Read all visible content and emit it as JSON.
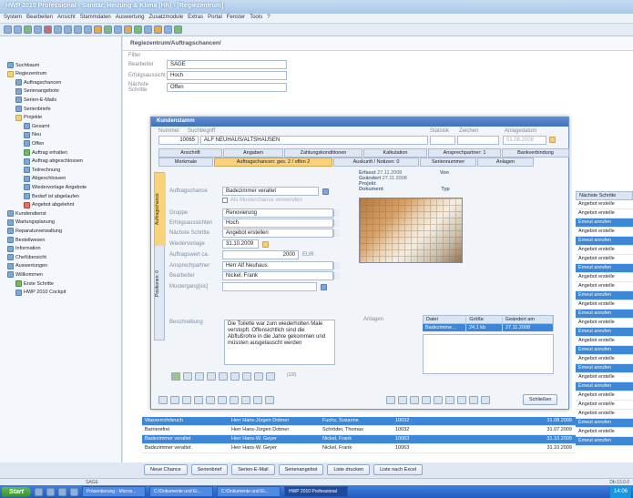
{
  "app": {
    "title": "HWP 2010 Professional - Sanitär, Heizung & Klima (Hh) - [Regiezentrum]"
  },
  "menu": [
    "System",
    "Bearbeiten",
    "Ansicht",
    "Stammdaten",
    "Auswertung",
    "Zusatzmodule",
    "Extras",
    "Portal",
    "Fenster",
    "Tools",
    "?"
  ],
  "sidebar": {
    "items": [
      {
        "label": "Suchbaum",
        "indent": 0,
        "icon": "search-icon"
      },
      {
        "label": "Regiezentrum",
        "indent": 0,
        "icon": "folder-icon"
      },
      {
        "label": "Auftragschancen",
        "indent": 1,
        "icon": "star-icon"
      },
      {
        "label": "Serienangebote",
        "indent": 1,
        "icon": "document-icon"
      },
      {
        "label": "Serien-E-Mails",
        "indent": 1,
        "icon": "mail-icon"
      },
      {
        "label": "Serienbriefe",
        "indent": 1,
        "icon": "letter-icon"
      },
      {
        "label": "Projekte",
        "indent": 1,
        "icon": "folder-icon"
      },
      {
        "label": "Gesamt",
        "indent": 2,
        "icon": "list-icon"
      },
      {
        "label": "Neu",
        "indent": 2,
        "icon": "document-icon"
      },
      {
        "label": "Offen",
        "indent": 2,
        "icon": "document-icon"
      },
      {
        "label": "Auftrag erhalten",
        "indent": 2,
        "icon": "check-icon"
      },
      {
        "label": "Auftrag abgeschlossen",
        "indent": 2,
        "icon": "document-icon"
      },
      {
        "label": "Teilrechnung",
        "indent": 2,
        "icon": "document-icon"
      },
      {
        "label": "Abgeschlossen",
        "indent": 2,
        "icon": "document-icon"
      },
      {
        "label": "Wiedervorlage Angebote",
        "indent": 2,
        "icon": "document-icon"
      },
      {
        "label": "Bedarf ist abgelaufen",
        "indent": 2,
        "icon": "document-icon"
      },
      {
        "label": "Angebot abgelehnt",
        "indent": 2,
        "icon": "stop-icon"
      },
      {
        "label": "Kundendienst",
        "indent": 0,
        "icon": "tools-icon"
      },
      {
        "label": "Wartungsplanung",
        "indent": 0,
        "icon": "calendar-icon"
      },
      {
        "label": "Reparaturverwaltung",
        "indent": 0,
        "icon": "wrench-icon"
      },
      {
        "label": "Bestellwesen",
        "indent": 0,
        "icon": "cart-icon"
      },
      {
        "label": "Information",
        "indent": 0,
        "icon": "info-icon"
      },
      {
        "label": "Chefübersicht",
        "indent": 0,
        "icon": "info-icon"
      },
      {
        "label": "Auswertungen",
        "indent": 0,
        "icon": "chart-icon"
      },
      {
        "label": "Willkommen",
        "indent": 0,
        "icon": "info-icon"
      },
      {
        "label": "Erste Schritte",
        "indent": 1,
        "icon": "help-icon"
      },
      {
        "label": "HWP 2010 Cockpit",
        "indent": 1,
        "icon": "cockpit-icon"
      }
    ]
  },
  "main": {
    "header": "Regiezentrum/Auftragschancen/",
    "filter": {
      "title": "Filter",
      "fields": [
        {
          "label": "Bearbeiter",
          "value": "SAGE"
        },
        {
          "label": "Erfolgsaussicht",
          "value": "Hoch"
        },
        {
          "label": "Nächste Schritte",
          "value": "Offen"
        }
      ]
    }
  },
  "dialog": {
    "title": "Kundenstamm",
    "nummer_label": "Nummer",
    "suchbegriff_label": "Suchbegriff",
    "nummer": "10065",
    "suchbegriff": "ALF NEUHAUS/ALTSHAUSEN",
    "statistik_label": "Statistik",
    "zeichen_label": "Zeichen",
    "anlagedatum_label": "Anlagedatum",
    "anlagedatum": "01.08.2008",
    "tabs_top": [
      "Anschrift",
      "Angaben",
      "Zahlungskonditionen",
      "Kalkulation",
      "Ansprechpartner: 1",
      "Bankverbindung"
    ],
    "tabs_second": [
      "Merkmale",
      "Auftragschancen: ges. 2 / offen 2",
      "Auskunft / Notizen: 0",
      "Seriennummer",
      "Anlagen"
    ],
    "vtabs": [
      "Auftragschance",
      "Positionen: 0"
    ],
    "fields": [
      {
        "label": "Auftragschance",
        "value": "Badezimmer veraltet"
      },
      {
        "label": "",
        "value": "Als Musterchance verwenden"
      },
      {
        "label": "Gruppe",
        "value": "Renovierung"
      },
      {
        "label": "Erfolgsaussichten",
        "value": "Hoch"
      },
      {
        "label": "Nächste Schritte",
        "value": "Angebot erstellen"
      },
      {
        "label": "Wiedervorlage",
        "value": "31.10.2009"
      },
      {
        "label": "Auftragswert ca.",
        "value": "2000"
      },
      {
        "label": "Ansprechpartner",
        "value": "Herr Alf Neuhaus"
      },
      {
        "label": "Bearbeiter",
        "value": "Nickel, Frank"
      },
      {
        "label": "Mustergang[sic]",
        "value": ""
      },
      {
        "label": "Beschreibung",
        "value": "Die Toilette war zum wiederholten Male verstopft. Offensichtlich sind die Abflußrohre in die Jahre gekommen und müssten ausgetauscht werden"
      }
    ],
    "currency": "EUR",
    "info": {
      "erfasst_label": "Erfasst",
      "erfasst": "27.11.2008",
      "geaendert_label": "Geändert",
      "geaendert": "27.11.2008",
      "von_label": "Von",
      "projekt_label": "Projekt",
      "dokument_label": "Dokument",
      "typ_label": "Typ"
    },
    "anlagen": {
      "label": "Anlagen",
      "headers": [
        "Datei",
        "Größe",
        "Geändert am"
      ],
      "row": [
        "Badezimme...",
        "24,1 kb",
        "27.11.2008"
      ]
    },
    "record_counter": "(1/2)",
    "schliessen": "Schließen"
  },
  "right_column": {
    "header": "Nächste Schritte",
    "rows": [
      "Angebot erstelle",
      "Angebot erstelle",
      "Emeut anrufen",
      "Angebot erstelle",
      "Emeut anrufen",
      "Angebot erstelle",
      "Angebot erstelle",
      "Emeut anrufen",
      "Angebot erstelle",
      "Angebot erstelle",
      "Emeut anrufen",
      "Angebot erstelle",
      "Emeut anrufen",
      "Angebot erstelle",
      "Emeut anrufen",
      "Angebot erstelle",
      "Emeut anrufen",
      "Angebot erstelle",
      "Emeut anrufen",
      "Angebot erstelle",
      "Emeut anrufen",
      "Angebot erstelle",
      "Angebot erstelle",
      "Angebot erstelle",
      "Emeut anrufen",
      "Angebot erstelle",
      "Emeut anrufen"
    ],
    "highlighted": [
      2,
      4,
      7,
      10,
      12,
      14,
      16,
      18,
      20,
      24,
      26
    ]
  },
  "bottom_table": {
    "rows": [
      [
        "Wasserrohrbruch",
        "Herr Hans-Jürgen Dobner",
        "Fuchs, Susanne",
        "10032",
        "31.08.2009"
      ],
      [
        "Barrierefrei",
        "Herr Hans-Jürgen Dobner",
        "Schröder, Thomas",
        "10032",
        "31.07.2009"
      ],
      [
        "Badezimmer veraltet",
        "Herr Hans-W. Geyer",
        "Nickel, Frank",
        "10063",
        "31.10.2009"
      ],
      [
        "Badezimmer veraltet",
        "Herr Hans-W. Geyer",
        "Nickel, Frank",
        "10063",
        "31.10.2009"
      ]
    ],
    "highlighted": [
      0,
      2
    ]
  },
  "buttons": [
    "Neue Chance",
    "Serienbrief",
    "Serien-E-Mail",
    "Serienangebot",
    "Liste drucken",
    "Liste nach Excel"
  ],
  "status": {
    "left": "SAGE",
    "right": "Db:13.0.0"
  },
  "taskbar": {
    "start": "Start",
    "tasks": [
      "Präsentierung - Micros...",
      "C:\\Dokumente und Ei...",
      "C:\\Dokumente und Ei...",
      "HWP 2010 Professional"
    ],
    "active_task": 3,
    "clock": "14:06"
  }
}
